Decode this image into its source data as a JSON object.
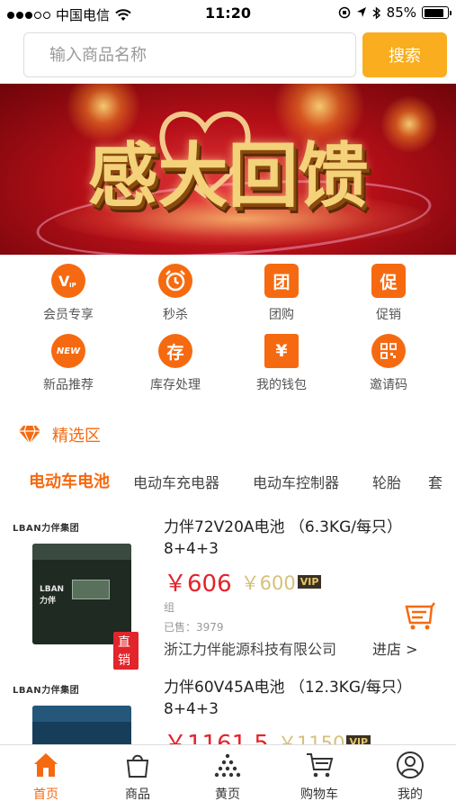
{
  "status_bar": {
    "carrier": "中国电信",
    "time": "11:20",
    "battery": "85%",
    "battery_level": 0.85
  },
  "search": {
    "placeholder": "输入商品名称",
    "button_label": "搜索"
  },
  "banner": {
    "text": "感大回馈"
  },
  "menu": [
    {
      "label": "会员专享",
      "icon": "vip-icon",
      "glyph": "V"
    },
    {
      "label": "秒杀",
      "icon": "alarm-clock-icon",
      "glyph": ""
    },
    {
      "label": "团购",
      "icon": "group-buy-icon",
      "glyph": "团"
    },
    {
      "label": "促销",
      "icon": "promotion-icon",
      "glyph": "促"
    },
    {
      "label": "新品推荐",
      "icon": "new-icon",
      "glyph": "NEW"
    },
    {
      "label": "库存处理",
      "icon": "stock-icon",
      "glyph": "存"
    },
    {
      "label": "我的钱包",
      "icon": "wallet-icon",
      "glyph": "¥"
    },
    {
      "label": "邀请码",
      "icon": "qr-code-icon",
      "glyph": ""
    }
  ],
  "section": {
    "title": "精选区",
    "icon": "diamond-icon"
  },
  "category_tabs": [
    "电动车电池",
    "电动车充电器",
    "电动车控制器",
    "轮胎",
    "套"
  ],
  "products": [
    {
      "brand": "LBAN力伴集团",
      "title": "力伴72V20A电池 （6.3KG/每只）8+4+3",
      "price": "￥606",
      "vip_price": "￥600",
      "vip_badge": "VIP",
      "unit": "组",
      "sold": "已售：3979",
      "company": "浙江力伴能源科技有限公司",
      "store_link": "进店 >",
      "tag": "直销"
    },
    {
      "brand": "LBAN力伴集团",
      "title": "力伴60V45A电池 （12.3KG/每只）8+4+3",
      "price": "￥1161.5",
      "vip_price": "￥1150",
      "vip_badge": "VIP"
    }
  ],
  "bottom_nav": [
    {
      "label": "首页",
      "icon": "home-icon",
      "active": true
    },
    {
      "label": "商品",
      "icon": "shopping-bag-icon",
      "active": false
    },
    {
      "label": "黄页",
      "icon": "yellow-pages-icon",
      "active": false
    },
    {
      "label": "购物车",
      "icon": "cart-icon",
      "active": false
    },
    {
      "label": "我的",
      "icon": "user-icon",
      "active": false
    }
  ],
  "colors": {
    "accent": "#f56a10",
    "search_button": "#f9ad1f",
    "price_red": "#e2242b",
    "vip_gold": "#d6c07b"
  }
}
